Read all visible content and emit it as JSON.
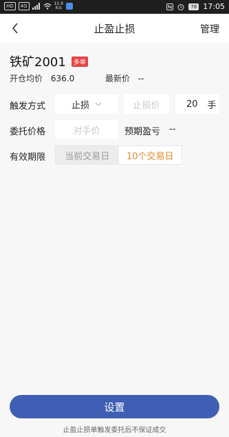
{
  "status_bar": {
    "chips": [
      "HD",
      "4G"
    ],
    "speed_top": "15.9",
    "speed_bottom": "K/s",
    "battery": "78",
    "time": "17:05"
  },
  "nav": {
    "title": "止盈止损",
    "manage_label": "管理"
  },
  "product": {
    "name": "铁矿2001",
    "badge": "多单"
  },
  "position": {
    "open_avg_label": "开仓均价",
    "open_avg_value": "636.0",
    "latest_label": "最新价",
    "latest_value": "--"
  },
  "trigger": {
    "label": "触发方式",
    "mode_value": "止损",
    "price_placeholder": "止损价",
    "quantity": "20",
    "unit": "手"
  },
  "order": {
    "label": "委托价格",
    "price_placeholder": "对手价",
    "expected_label": "预期盈亏",
    "expected_value": "--"
  },
  "validity": {
    "label": "有效期限",
    "options": [
      "当前交易日",
      "10个交易日"
    ],
    "selected_index": 1
  },
  "submit_label": "设置",
  "footnote": "止盈止损单触发委托后不保证成交"
}
